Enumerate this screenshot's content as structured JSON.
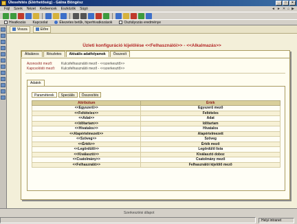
{
  "window": {
    "title": "Ülesehités (Elérhetőség) - Gálna Böngész",
    "controls": [
      "_",
      "□",
      "×"
    ]
  },
  "menubar": {
    "items": [
      "Fájl",
      "Szerk",
      "Nézet",
      "Kedvencek",
      "Eszközök",
      "Súgó"
    ],
    "right_tools": [
      "◄",
      "►",
      "✕",
      "⌂",
      "▶"
    ]
  },
  "linksbar": {
    "items": [
      "Hivatkozás",
      "Kapcsolat",
      "Ékezetes betűk, hiperhivatkozások",
      "Osztályozás eredménye"
    ]
  },
  "subtoolbar": {
    "items": [
      "Vissza",
      "Előre"
    ]
  },
  "page": {
    "title": "Üzleti konfiguráció kijelölése <<Felhasználói>> - <<Alkalmazás>>"
  },
  "tabs": [
    "Általános",
    "Részletes",
    "Aktuális adatfolyamok",
    "Összesít"
  ],
  "info_rows": [
    {
      "key": "Azonosító mező:",
      "value": "Kulcsfelhasználói mező - <<szerkesztő>>"
    },
    {
      "key": "Kapcsolódó mező:",
      "value": "Kulcsfelhasználói mező - <<szerkesztő>>"
    }
  ],
  "inner": {
    "tab": "Adatok",
    "subtabs": [
      "Paraméterek",
      "Speciális",
      "Összesítés"
    ]
  },
  "table": {
    "headers": [
      "Attribútum",
      "Érték"
    ],
    "rows": [
      [
        "<<Egyszerű>>",
        "Egyszerű mező"
      ],
      [
        "<<Feltételes>>",
        "Feltételes"
      ],
      [
        "<<Adat>>",
        "Adat"
      ],
      [
        "<<Időtartam>>",
        "Időtartam"
      ],
      [
        "<<Hivatalos>>",
        "Hivatalos"
      ],
      [
        "<<Alapértelmezett>>",
        "Alapértelmezett"
      ],
      [
        "<<Szöveg>>",
        "Szöveg"
      ],
      [
        "<<Érték>>",
        "Érték mező"
      ],
      [
        "<<Legördülő>>",
        "Legördülő lista"
      ],
      [
        "<<Kiválasztó>>",
        "Kiválasztó doboz"
      ],
      [
        "<<Csatolmány>>",
        "Csatolmány mező"
      ],
      [
        "<<Felhasználó>>",
        "Felhasználói kijelölő mező"
      ]
    ]
  },
  "statusbar": {
    "footer_text": "Szerkesztési állapot",
    "zone": "Helyi intranet"
  },
  "colors": {
    "title_red": "#b22222",
    "panel_bg": "#fffdf0",
    "header_bg": "#d9cf9b",
    "border": "#a89a60"
  }
}
